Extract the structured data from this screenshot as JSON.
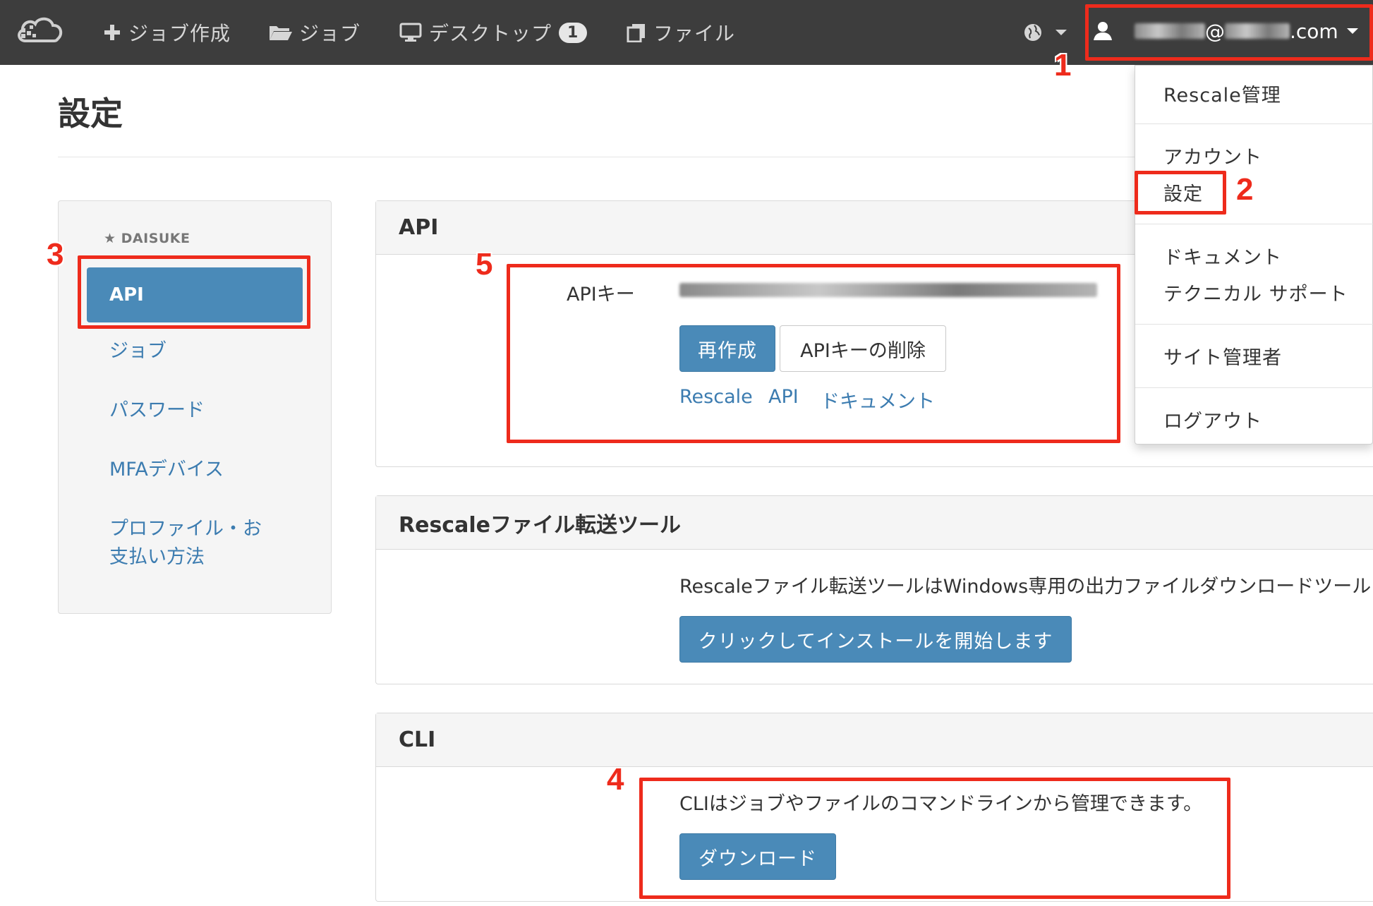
{
  "navbar": {
    "items": [
      {
        "label": "ジョブ作成",
        "icon": "plus-icon"
      },
      {
        "label": "ジョブ",
        "icon": "folder-icon"
      },
      {
        "label": "デスクトップ",
        "icon": "monitor-icon",
        "badge": "1"
      },
      {
        "label": "ファイル",
        "icon": "files-icon"
      }
    ],
    "user_email_suffix": ".com",
    "at_sign": "@",
    "background": "#3d3d3d"
  },
  "page": {
    "title": "設定"
  },
  "sidebar": {
    "user": "★ DAISUKE",
    "active_item": "API",
    "items": [
      "ジョブ",
      "パスワード",
      "MFAデバイス",
      "プロファイル・お",
      "支払い方法"
    ]
  },
  "api_panel": {
    "title": "API",
    "key_label": "APIキー",
    "regenerate_button": "再作成",
    "delete_button": "APIキーの削除",
    "doc_links": [
      "Rescale",
      "API",
      "ドキュメント"
    ]
  },
  "transfer_panel": {
    "title": "Rescaleファイル転送ツール",
    "description": "Rescaleファイル転送ツールはWindows専用の出力ファイルダウンロードツール",
    "install_button": "クリックしてインストールを開始します"
  },
  "cli_panel": {
    "title": "CLI",
    "description": "CLIはジョブやファイルのコマンドラインから管理できます。",
    "download_button": "ダウンロード"
  },
  "dropdown": {
    "items": [
      "Rescale管理",
      "アカウント",
      "設定",
      "ドキュメント",
      "テクニカル サポート",
      "サイト管理者",
      "ログアウト"
    ]
  },
  "annotations": {
    "steps": [
      "1",
      "2",
      "3",
      "4",
      "5"
    ],
    "color": "#ee2b1c"
  },
  "accent_color": "#4a8ab8"
}
